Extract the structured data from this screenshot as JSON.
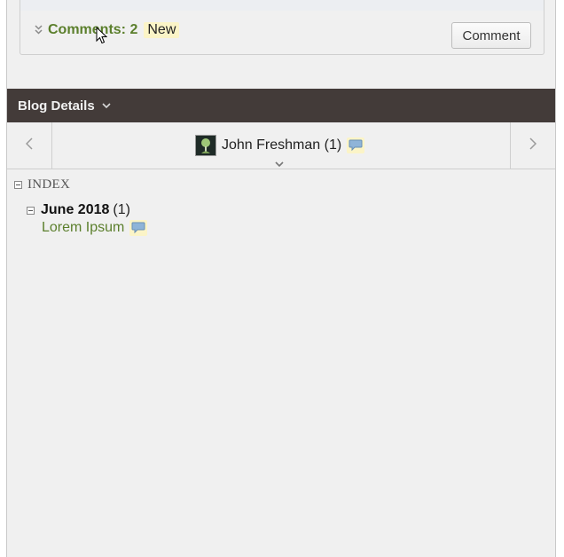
{
  "comments": {
    "label": "Comments: 2",
    "new_badge": "New",
    "comment_button": "Comment"
  },
  "blog": {
    "header_title": "Blog Details"
  },
  "author_nav": {
    "name": "John Freshman (1)"
  },
  "index": {
    "label": "INDEX",
    "month": "June 2018",
    "month_count": "(1)",
    "post": "Lorem Ipsum"
  },
  "icons": {
    "comment_bubble": "comment-bubble-icon",
    "prev": "chevron-left-icon",
    "next": "chevron-right-icon",
    "expand": "chevron-down-icon",
    "collapse": "minus-box-icon"
  },
  "colors": {
    "header_bg": "#433b39",
    "green_link": "#5b7f2c",
    "highlight": "#fbf4c7"
  }
}
